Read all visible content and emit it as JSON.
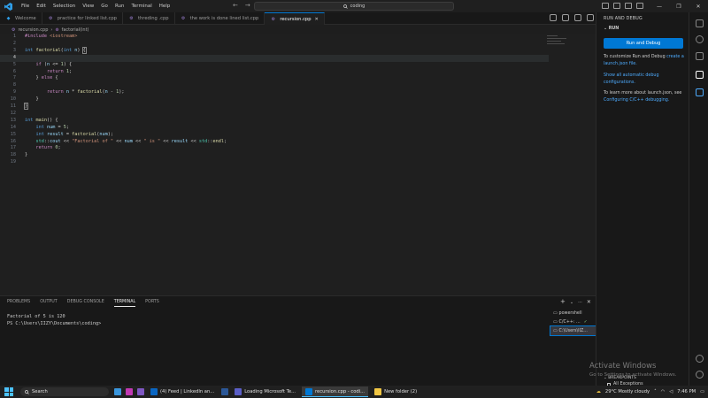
{
  "titlebar": {
    "menu": [
      "File",
      "Edit",
      "Selection",
      "View",
      "Go",
      "Run",
      "Terminal",
      "Help"
    ],
    "search": "coding",
    "back": "←",
    "forward": "→"
  },
  "tabs": [
    {
      "label": "Welcome",
      "active": false
    },
    {
      "label": "practice for linked list.cpp",
      "active": false
    },
    {
      "label": "threding .cpp",
      "active": false
    },
    {
      "label": "the work is done lined list.cpp",
      "active": false
    },
    {
      "label": "recursion.cpp",
      "active": true
    }
  ],
  "breadcrumb": {
    "file": "recursion.cpp",
    "symbol": "factorial(int)"
  },
  "code": {
    "l1": {
      "n": "1",
      "pre": "#include",
      "rest": " <iostream>"
    },
    "l3": {
      "n": "3"
    },
    "l5": {
      "n": "5"
    },
    "l6": {
      "n": "6"
    },
    "l7": {
      "n": "7"
    },
    "l8": {
      "n": "8"
    },
    "l9": {
      "n": "9"
    },
    "l10": {
      "n": "10"
    },
    "l11": {
      "n": "11"
    },
    "l12": {
      "n": "12"
    },
    "l13": {
      "n": "13"
    },
    "l14": {
      "n": "14"
    },
    "l15": {
      "n": "15"
    },
    "l16": {
      "n": "16"
    },
    "l17": {
      "n": "17"
    },
    "l18": {
      "n": "18"
    },
    "l19": {
      "n": "19"
    },
    "numbers": [
      "2",
      "4"
    ]
  },
  "panel": {
    "tabs": [
      "PROBLEMS",
      "OUTPUT",
      "DEBUG CONSOLE",
      "TERMINAL",
      "PORTS"
    ],
    "terminal_lines": [
      "Factorial of 5 is 120",
      "PS C:\\Users\\IIZY\\Documents\\coding>"
    ],
    "terminals": [
      "powershell",
      "C/C++: ...",
      "C:\\Users\\IIZ..."
    ]
  },
  "sidebar": {
    "header": "RUN AND DEBUG",
    "section": "RUN",
    "run_button": "Run and Debug",
    "customize_pre": "To customize Run and Debug",
    "customize_link": "create a launch.json file.",
    "auto_debug": "Show all automatic debug configurations.",
    "learn_pre": "To learn more about launch.json, see",
    "learn_link": "Configuring C/C++ debugging.",
    "breakpoints": "BREAKPOINTS",
    "all_exceptions": "All Exceptions"
  },
  "watermark": {
    "title": "Activate Windows",
    "sub": "Go to Settings to activate Windows."
  },
  "taskbar": {
    "search": "Search",
    "apps": [
      {
        "label": "(4) Feed | LinkedIn an...",
        "color": "#0a66c2",
        "active": false
      },
      {
        "label": "Loading Microsoft Te...",
        "color": "#5b5fc7",
        "active": false
      },
      {
        "label": "recursion.cpp - codi...",
        "color": "#0078d4",
        "active": true
      },
      {
        "label": "New folder (2)",
        "color": "#f2c744",
        "active": false
      }
    ],
    "weather": "29°C  Mostly cloudy",
    "time": "7:46 PM"
  }
}
